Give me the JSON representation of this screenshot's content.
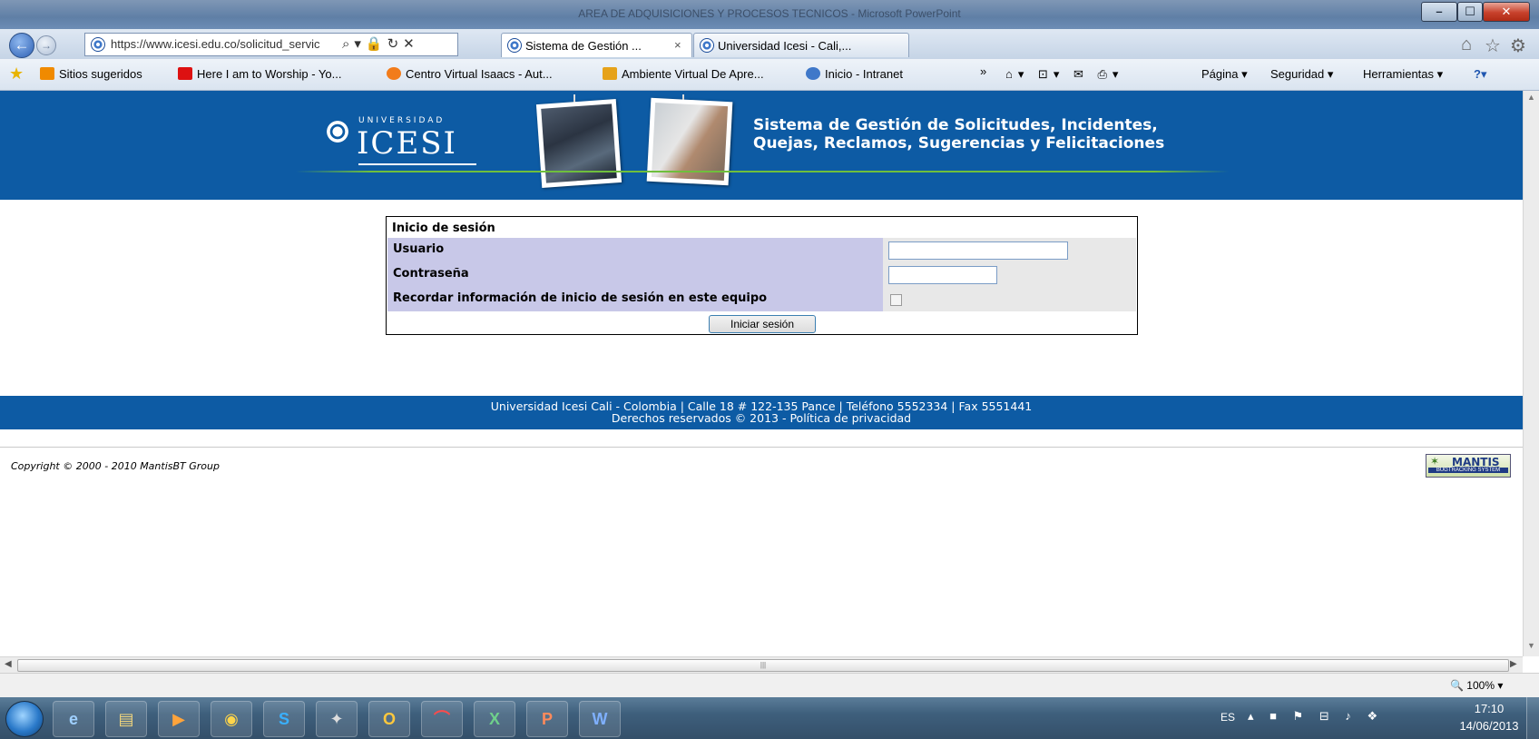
{
  "window": {
    "title": "AREA DE ADQUISICIONES Y PROCESOS TECNICOS - Microsoft PowerPoint"
  },
  "browser": {
    "address_url": "https://www.icesi.edu.co/solicitud_servic",
    "tabs": [
      {
        "label": "Sistema de Gestión ..."
      },
      {
        "label": "Universidad Icesi - Cali,..."
      }
    ],
    "favorites": [
      {
        "label": "Sitios sugeridos"
      },
      {
        "label": "Here I am to Worship - Yo..."
      },
      {
        "label": "Centro Virtual Isaacs - Aut..."
      },
      {
        "label": "Ambiente Virtual De Apre..."
      },
      {
        "label": "Inicio - Intranet"
      }
    ],
    "commands": {
      "page": "Página ▾",
      "security": "Seguridad ▾",
      "tools": "Herramientas ▾"
    },
    "zoom": "100%"
  },
  "header": {
    "logo_small": "UNIVERSIDAD",
    "logo_name": "ICESI",
    "title_line1": "Sistema de Gestión de Solicitudes, Incidentes,",
    "title_line2": "Quejas, Reclamos, Sugerencias y Felicitaciones"
  },
  "login": {
    "heading": "Inicio de sesión",
    "username_label": "Usuario",
    "username_value": "",
    "password_label": "Contraseña",
    "password_value": "",
    "remember_label": "Recordar información de inicio de sesión en este equipo",
    "remember_checked": false,
    "submit_label": "Iniciar sesión"
  },
  "footer": {
    "line1": "Universidad Icesi Cali - Colombia | Calle 18 # 122-135 Pance | Teléfono 5552334 | Fax 5551441",
    "line2": "Derechos reservados © 2013 - Política de privacidad"
  },
  "copyright": "Copyright © 2000 - 2010 MantisBT Group",
  "mantis_logo": {
    "name": "MANTIS",
    "tagline": "BUGTRACKING SYSTEM"
  },
  "taskbar": {
    "apps": [
      "ie-icon",
      "explorer-icon",
      "media-icon",
      "chrome-icon",
      "skype-icon",
      "app-icon",
      "outlook-icon",
      "acrobat-icon",
      "excel-icon",
      "powerpoint-icon",
      "word-icon"
    ],
    "language": "ES",
    "time": "17:10",
    "date": "14/06/2013"
  }
}
